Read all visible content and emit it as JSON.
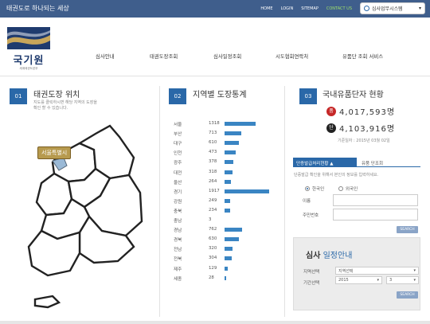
{
  "topbar": {
    "slogan": "태권도로 하나되는 세상",
    "links": [
      "HOME",
      "LOGIN",
      "SITEMAP"
    ],
    "contact": "CONTACT US",
    "system_select": "심사업무시스템"
  },
  "logo": {
    "name": "국기원",
    "sub": "세계태권도본부"
  },
  "nav": [
    "심사안내",
    "태권도장조회",
    "심사일정조회",
    "시도협회연락처",
    "유품단 조회 서비스"
  ],
  "sections": [
    {
      "num": "01",
      "title": "태권도장 위치",
      "desc": [
        "지도를 클릭하시면 해당 지역의 도장을",
        "확인 할 수 있습니다."
      ]
    },
    {
      "num": "02",
      "title": "지역별 도장통계"
    },
    {
      "num": "03",
      "title": "국내유품단자 현황"
    }
  ],
  "map": {
    "selected_label": "서울특별시"
  },
  "stats": [
    {
      "region": "서울",
      "value": 1318,
      "fraction": 0.69
    },
    {
      "region": "부산",
      "value": 713,
      "fraction": 0.37
    },
    {
      "region": "대구",
      "value": 610,
      "fraction": 0.32
    },
    {
      "region": "인천",
      "value": 473,
      "fraction": 0.25
    },
    {
      "region": "광주",
      "value": 378,
      "fraction": 0.2
    },
    {
      "region": "대전",
      "value": 318,
      "fraction": 0.17
    },
    {
      "region": "울산",
      "value": 264,
      "fraction": 0.14
    },
    {
      "region": "경기",
      "value": 1917,
      "fraction": 1.0
    },
    {
      "region": "강원",
      "value": 249,
      "fraction": 0.13
    },
    {
      "region": "충북",
      "value": 234,
      "fraction": 0.12
    },
    {
      "region": "충남",
      "value": 3
    },
    {
      "region": "경남",
      "value": 762,
      "fraction": 0.4
    },
    {
      "region": "경북",
      "value": 630,
      "fraction": 0.33
    },
    {
      "region": "전남",
      "value": 320,
      "fraction": 0.17
    },
    {
      "region": "전북",
      "value": 304,
      "fraction": 0.16
    },
    {
      "region": "제주",
      "value": 129,
      "fraction": 0.07
    },
    {
      "region": "세종",
      "value": 28,
      "fraction": 0.015
    }
  ],
  "counts": {
    "poom_icon": "품",
    "poom_value": "4,017,593명",
    "dan_icon": "단",
    "dan_value": "4,103,916명",
    "base_date": "기준일자 : 2015년 03월 02일"
  },
  "lookup": {
    "tab_active": "단증발급처리현황",
    "tab_inactive": "유품 단조회",
    "desc": "단증발급 확인을 위해서 본인의 정보를 입력하세요.",
    "radio_korean": "한국인",
    "radio_foreigner": "외국인",
    "name_label": "이름",
    "id_label": "주민번호",
    "search_button": "SEARCH"
  },
  "schedule": {
    "title_prefix": "심사",
    "title_main": "일정안내",
    "region_label": "지역선택",
    "region_value": "지역선택",
    "period_label": "기간선택",
    "year_value": "2015",
    "month_value": "3",
    "search_button": "SEARCH"
  },
  "colors": {
    "topbar": "#3f5e8c",
    "accent": "#2a68a8",
    "bar": "#3a85c3",
    "poom": "#c62828",
    "dan": "#222222",
    "contact": "#9fe06a"
  }
}
